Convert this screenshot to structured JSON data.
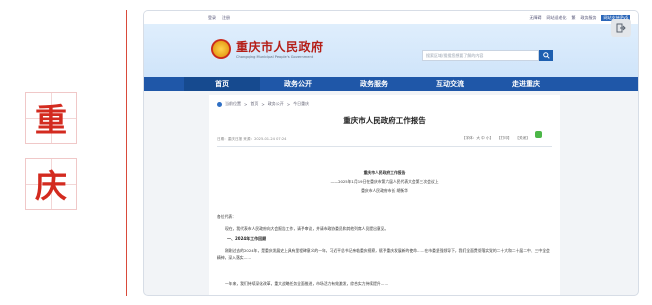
{
  "left_decoration": {
    "char1": "重",
    "char2": "庆"
  },
  "site": {
    "topbar": {
      "links": [
        "登录",
        "注册"
      ],
      "right_items": [
        "无障碍",
        "网站适老化",
        "繁",
        "政务服务",
        "网站支持IPv6"
      ]
    },
    "title": "重庆市人民政府",
    "subtitle": "Chongqing Municipal People's Government",
    "search_placeholder": "搜索区域/搜搜您想要了解的内容",
    "nav": [
      "首页",
      "政务公开",
      "政务服务",
      "互动交流",
      "走进重庆"
    ]
  },
  "article": {
    "breadcrumb": [
      "当前位置",
      "首页",
      "政务公开",
      "今日重庆"
    ],
    "title": "重庆市人民政府工作报告",
    "meta": "日期：重庆日报   来源：2025-01-24 07:24",
    "share_buttons": [
      "【字体：大 中 小】",
      "【打印】",
      "【关闭】"
    ],
    "center_lines": [
      "重庆市人民政府工作报告",
      "——2025年1月19日在重庆市第六届人民代表大会第三次会议上",
      "重庆市人民政府市长 胡衡华"
    ],
    "greeting": "各位代表：",
    "intro": "现在，我代表市人民政府向大会报告工作，请予审议，并请市政协委员和其他列席人员提出意见。",
    "section1": "一、2024年工作回顾",
    "para1": "刚刚过去的2024年，是重庆发展史上具有里程碑意义的一年，习近平总书记亲临重庆视察，赋予重庆发展新的使命……在市委坚强领导下，我们全面贯彻落实党的二十大和二十届二中、三中全会精神，深入落实……",
    "para2": "一年来，我们持续深化改革，重大战略任务全面推进，市场活力有效激发，综合实力持续提升……"
  }
}
